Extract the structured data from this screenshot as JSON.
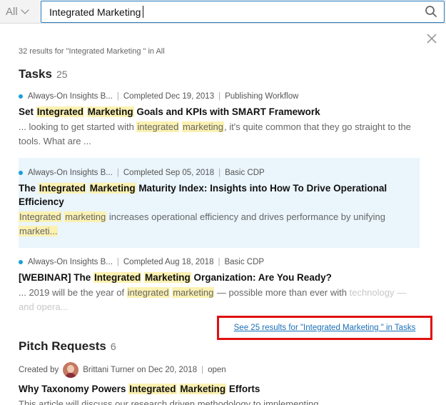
{
  "search": {
    "scope": "All",
    "query": "Integrated Marketing"
  },
  "summary": "32 results for \"Integrated Marketing \" in All",
  "tasks": {
    "title": "Tasks",
    "count": "25",
    "items": [
      {
        "meta": [
          "Always-On Insights B...",
          "Completed Dec 19, 2013",
          "Publishing Workflow"
        ],
        "title": [
          "Set ",
          "Integrated",
          " ",
          "Marketing",
          " Goals and KPIs with SMART Framework"
        ],
        "snippet": [
          "... looking to get started with ",
          "integrated",
          " ",
          "marketing",
          ", it's quite common that they go straight to the tools. What are ..."
        ]
      },
      {
        "meta": [
          "Always-On Insights B...",
          "Completed Sep 05, 2018",
          "Basic CDP"
        ],
        "title": [
          "The ",
          "Integrated",
          " ",
          "Marketing",
          " Maturity Index: Insights into How To Drive Operational Efficiency"
        ],
        "snippet": [
          "",
          "Integrated",
          " ",
          "marketing",
          " increases operational efficiency and drives performance by unifying ",
          "marketi...",
          ""
        ]
      },
      {
        "meta": [
          "Always-On Insights B...",
          "Completed Aug 18, 2018",
          "Basic CDP"
        ],
        "title": [
          "[WEBINAR] The ",
          "Integrated",
          " ",
          "Marketing",
          " Organization: Are You Ready?"
        ],
        "snippet": [
          "... 2019 will be the year of ",
          "integrated",
          " ",
          "marketing",
          " — possible more than ever with "
        ],
        "snippet_fade": "technology — and opera..."
      }
    ],
    "see_all": "See 25 results for \"Integrated Marketing \" in Tasks"
  },
  "pitch": {
    "title": "Pitch Requests",
    "count": "6",
    "items": [
      {
        "created_by_label": "Created by",
        "author": "Brittani Turner",
        "date": "on Dec 20, 2018",
        "status": "open",
        "title": [
          "Why Taxonomy Powers ",
          "Integrated",
          " ",
          "Marketing",
          " Efforts"
        ],
        "snippet": "This article will discuss our research driven methodology to implementing"
      }
    ]
  }
}
